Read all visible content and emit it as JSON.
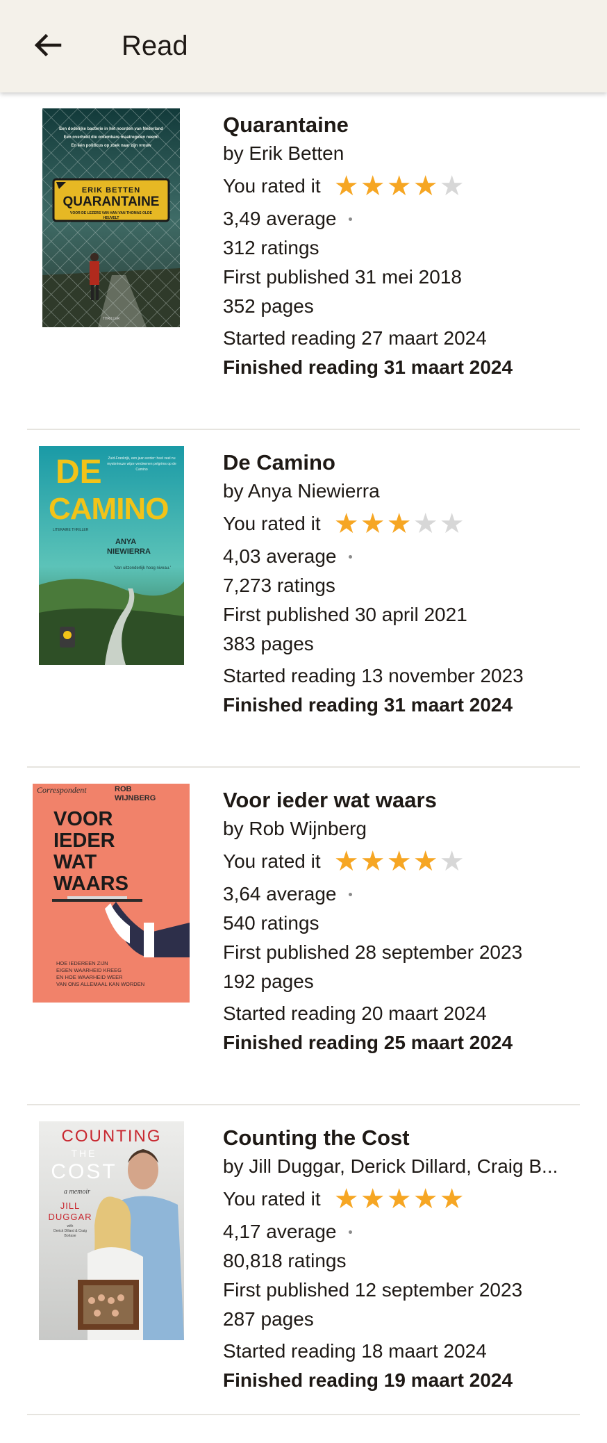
{
  "header": {
    "title": "Read",
    "back_icon": "arrow-left-icon"
  },
  "rating_colors": {
    "filled": "#f6a623",
    "empty": "#d7d7d7"
  },
  "books": [
    {
      "title": "Quarantaine",
      "author": "by Erik Betten",
      "rated_label": "You rated it",
      "rating": 4,
      "average": "3,49 average",
      "ratings_count": "312 ratings",
      "published": "First published 31 mei 2018",
      "pages": "352 pages",
      "started": "Started reading 27 maart 2024",
      "finished": "Finished reading 31 maart 2024",
      "cover": {
        "tagline": [
          "Een dodelijke bacterie in het noorden van Nederland",
          "Een overheid die ontembare maatregelen neemt",
          "En één politicus op zoek naar zijn vrouw"
        ],
        "author": "ERIK BETTEN",
        "title": "QUARANTAINE",
        "subtitle": "VOOR DE LEZERS VAN HAN VAN THOMAS OLDE HEUVELT",
        "publisher": "THRILLER"
      }
    },
    {
      "title": "De Camino",
      "author": "by Anya Niewierra",
      "rated_label": "You rated it",
      "rating": 3,
      "average": "4,03 average",
      "ratings_count": "7,273 ratings",
      "published": "First published 30 april 2021",
      "pages": "383 pages",
      "started": "Started reading 13 november 2023",
      "finished": "Finished reading 31 maart 2024",
      "cover": {
        "title1": "DE",
        "title2": "CAMINO",
        "author1": "ANYA",
        "author2": "NIEWIERRA",
        "genre": "LITERAIRE THRILLER",
        "blurb": "Zuid-Frankrijk, een jaar eerder: heel veel nu mysterieuze wijze verdwenen pelgrims op de Camino",
        "quote": "'Van uitzonderlijk hoog niveau.'"
      }
    },
    {
      "title": "Voor ieder wat waars",
      "author": "by Rob Wijnberg",
      "rated_label": "You rated it",
      "rating": 4,
      "average": "3,64 average",
      "ratings_count": "540 ratings",
      "published": "First published 28 september 2023",
      "pages": "192 pages",
      "started": "Started reading 20 maart 2024",
      "finished": "Finished reading 25 maart 2024",
      "cover": {
        "brand": "Correspondent",
        "author1": "ROB",
        "author2": "WIJNBERG",
        "title_lines": [
          "VOOR",
          "IEDER",
          "WAT",
          "WAARS"
        ],
        "subtitle_lines": [
          "HOE IEDEREEN ZIJN",
          "EIGEN WAARHEID KREEG",
          "EN HOE WAARHEID WEER",
          "VAN ONS ALLEMAAL KAN WORDEN"
        ]
      }
    },
    {
      "title": "Counting the Cost",
      "author": "by Jill Duggar, Derick Dillard, Craig B...",
      "rated_label": "You rated it",
      "rating": 5,
      "average": "4,17 average",
      "ratings_count": "80,818 ratings",
      "published": "First published 12 september 2023",
      "pages": "287 pages",
      "started": "Started reading 18 maart 2024",
      "finished": "Finished reading 19 maart 2024",
      "cover": {
        "title1": "COUNTING",
        "title2": "THE",
        "title3": "COST",
        "subtitle": "a memoir",
        "author1": "JILL",
        "author2": "DUGGAR",
        "with_line": "with",
        "coauthors": "Derick Dillard & Craig Borlase"
      }
    }
  ]
}
